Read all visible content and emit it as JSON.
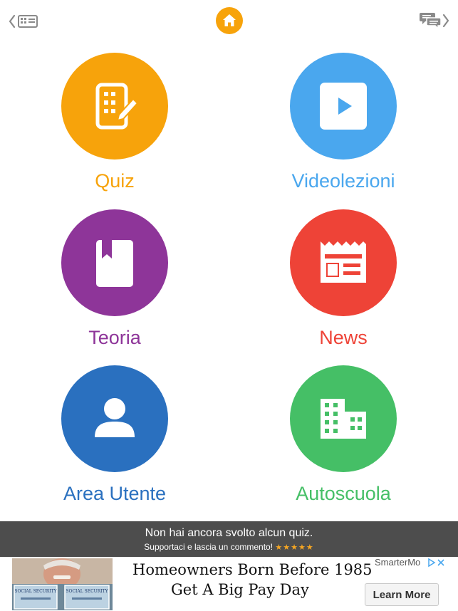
{
  "header": {
    "left_icon": "back-to-keypad-icon",
    "center_icon": "home-icon",
    "right_icon": "chat-bubbles-forward-icon",
    "accent_color": "#f7a30b"
  },
  "tiles": [
    {
      "label": "Quiz",
      "icon": "quiz-grid-pencil-icon",
      "color": "#f7a30b"
    },
    {
      "label": "Videolezioni",
      "icon": "play-video-icon",
      "color": "#4aa7ee"
    },
    {
      "label": "Teoria",
      "icon": "book-bookmark-icon",
      "color": "#8e3599"
    },
    {
      "label": "News",
      "icon": "newspaper-icon",
      "color": "#ee4337"
    },
    {
      "label": "Area Utente",
      "icon": "user-icon",
      "color": "#2a70bf"
    },
    {
      "label": "Autoscuola",
      "icon": "building-icon",
      "color": "#45bf66"
    }
  ],
  "banner": {
    "message": "Non hai ancora svolto alcun quiz.",
    "subtext": "Supportaci e lascia un commento!",
    "stars": "★★★★★",
    "background": "#4d4d4d"
  },
  "ad": {
    "headline_line1": "Homeowners Born Before 1985",
    "headline_line2": "Get A Big Pay Day",
    "sponsor": "SmarterMo",
    "cta_label": "Learn More",
    "card_text": "SOCIAL SECURITY"
  }
}
